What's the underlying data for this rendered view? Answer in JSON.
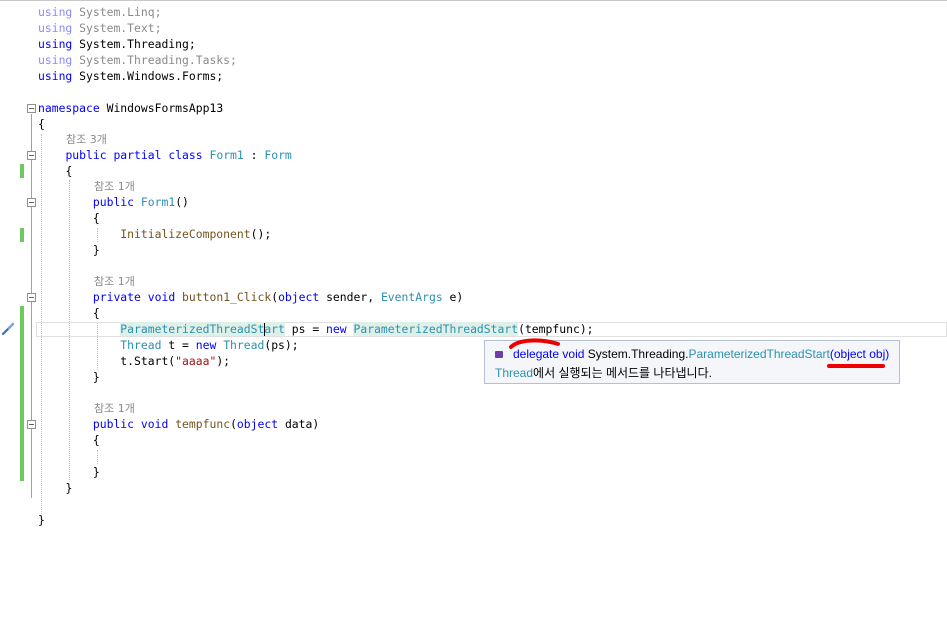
{
  "code": {
    "using1": {
      "kw": "using",
      "ns": "System.Linq;"
    },
    "using2": {
      "kw": "using",
      "ns": "System.Text;"
    },
    "using3": {
      "kw": "using",
      "ns": "System.Threading;"
    },
    "using4": {
      "kw": "using",
      "ns": "System.Threading.Tasks;"
    },
    "using5": {
      "kw": "using",
      "ns": "System.Windows.Forms;"
    },
    "namespace_kw": "namespace",
    "namespace_name": "WindowsFormsApp13",
    "brace_open": "{",
    "brace_close": "}",
    "ref_class": "참조 3개",
    "class_decl": {
      "public": "public",
      "partial": "partial",
      "class": "class",
      "name": "Form1",
      "colon": ":",
      "base": "Form"
    },
    "ref_ctor": "참조 1개",
    "ctor_decl": {
      "public": "public",
      "name": "Form1",
      "parens": "()"
    },
    "init_call": {
      "name": "InitializeComponent",
      "rest": "();"
    },
    "ref_click": "참조 1개",
    "click_decl": {
      "private": "private",
      "void": "void",
      "name": "button1_Click",
      "p1type": "object",
      "p1": "sender",
      "p2type": "EventArgs",
      "p2": "e"
    },
    "stmt1": {
      "type_a": "ParameterizedThreadSt",
      "type_b": "art",
      "var": "ps",
      "eq": "=",
      "new": "new",
      "ctor": "ParameterizedThreadStart",
      "arg": "tempfunc"
    },
    "stmt2": {
      "type": "Thread",
      "var": "t",
      "eq": "=",
      "new": "new",
      "ctor": "Thread",
      "arg": "ps"
    },
    "stmt3": {
      "call": "t.Start(",
      "str": "\"aaaa\"",
      "end": ");"
    },
    "ref_temp": "참조 1개",
    "temp_decl": {
      "public": "public",
      "void": "void",
      "name": "tempfunc",
      "ptype": "object",
      "pname": "data"
    }
  },
  "tooltip": {
    "icon": "delegate-icon",
    "delegate_kw": "delegate",
    "void_kw": "void",
    "namespace": "System.Threading.",
    "type_name": "ParameterizedThreadStart",
    "params": "(object obj)",
    "desc_link": "Thread",
    "desc_text": "에서 실행되는 메서드를 나타냅니다."
  },
  "colors": {
    "keyword": "#0000ff",
    "type": "#2b91af",
    "method": "#74531f",
    "string": "#a31515",
    "change_bar": "#6bcb5c",
    "annotation": "#ee0000"
  }
}
